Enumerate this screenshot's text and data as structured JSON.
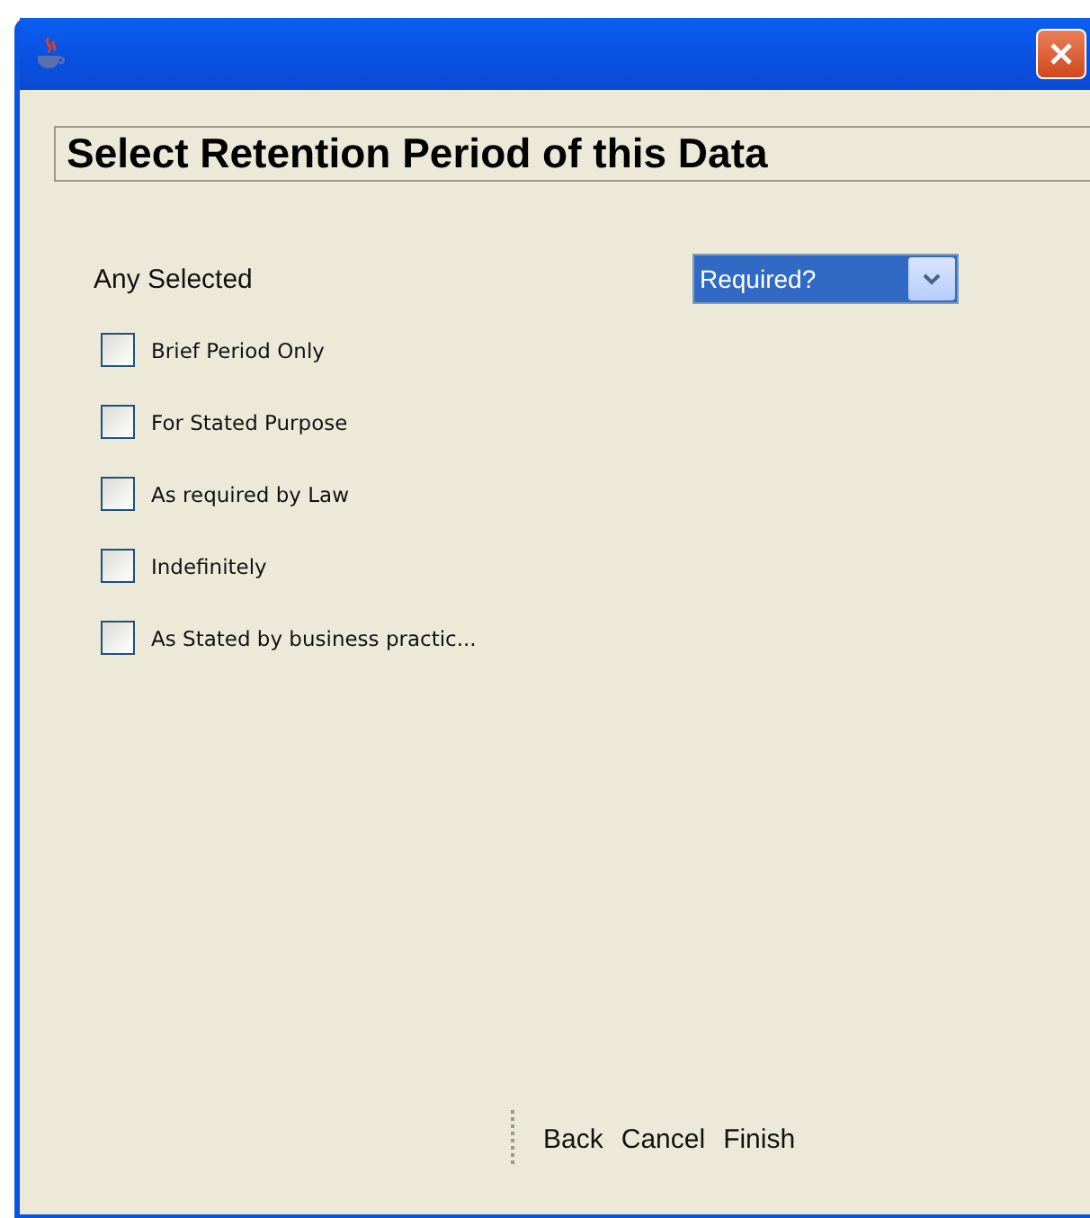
{
  "heading": "Select Retention Period of this Data",
  "selector": {
    "label": "Any Selected",
    "value": "Required?"
  },
  "options": [
    {
      "label": "Brief Period Only",
      "checked": false
    },
    {
      "label": "For Stated Purpose",
      "checked": false
    },
    {
      "label": "As required by Law",
      "checked": false
    },
    {
      "label": "Indefinitely",
      "checked": false
    },
    {
      "label": "As Stated by business practic...",
      "checked": false
    }
  ],
  "buttons": [
    "Back",
    "Cancel",
    "Finish"
  ]
}
